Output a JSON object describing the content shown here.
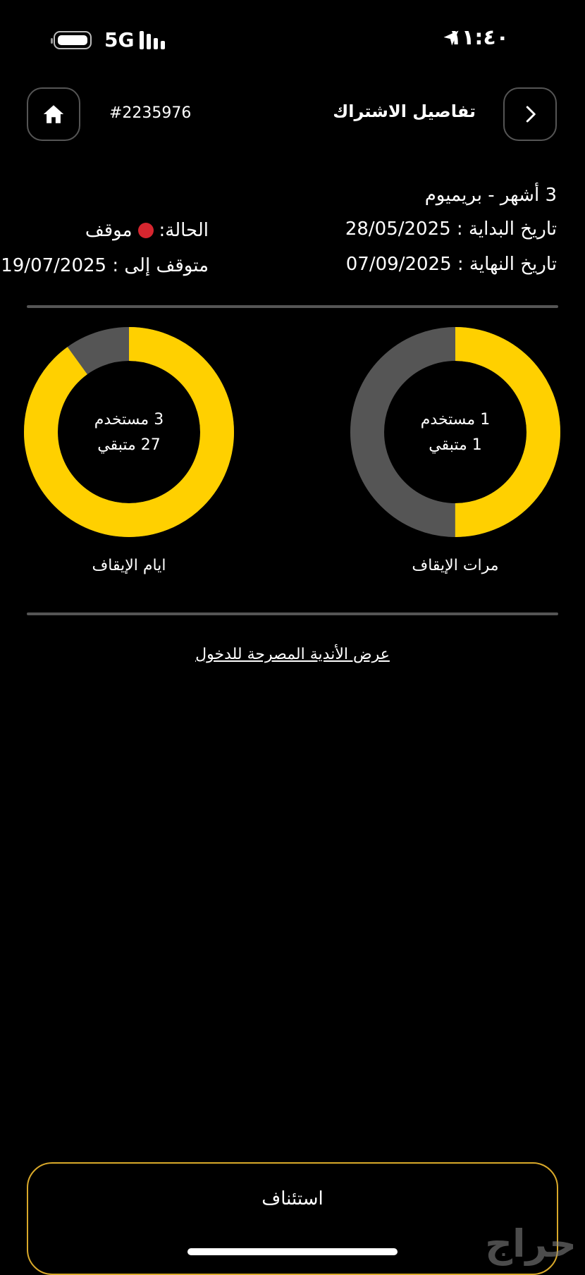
{
  "status_bar": {
    "time": "١١:٤٠",
    "network": "5G"
  },
  "header": {
    "title": "تفاصيل الاشتراك",
    "subscription_id": "#2235976"
  },
  "subscription": {
    "plan": "3 أشهر - بريميوم",
    "start_date": "تاريخ البداية : 28/05/2025",
    "end_date": "تاريخ النهاية : 07/09/2025",
    "status_label": "الحالة:",
    "status_value": "موقف",
    "status_color": "#d6262f",
    "paused_until": "متوقف إلى : 19/07/2025"
  },
  "freeze_times": {
    "used": "1 مستخدم",
    "remaining": "1 متبقي",
    "label": "مرات الإيقاف",
    "used_count": 1,
    "remaining_count": 1
  },
  "freeze_days": {
    "used": "3 مستخدم",
    "remaining": "27 متبقي",
    "label": "ايام الإيقاف",
    "used_count": 3,
    "remaining_count": 27
  },
  "colors": {
    "accent": "#FFD000",
    "track": "#555555",
    "button_border": "#d9a92a"
  },
  "links": {
    "allowed_clubs": "عرض الأندية المصرحة للدخول"
  },
  "actions": {
    "resume": "استئناف"
  },
  "watermark": "حراج"
}
